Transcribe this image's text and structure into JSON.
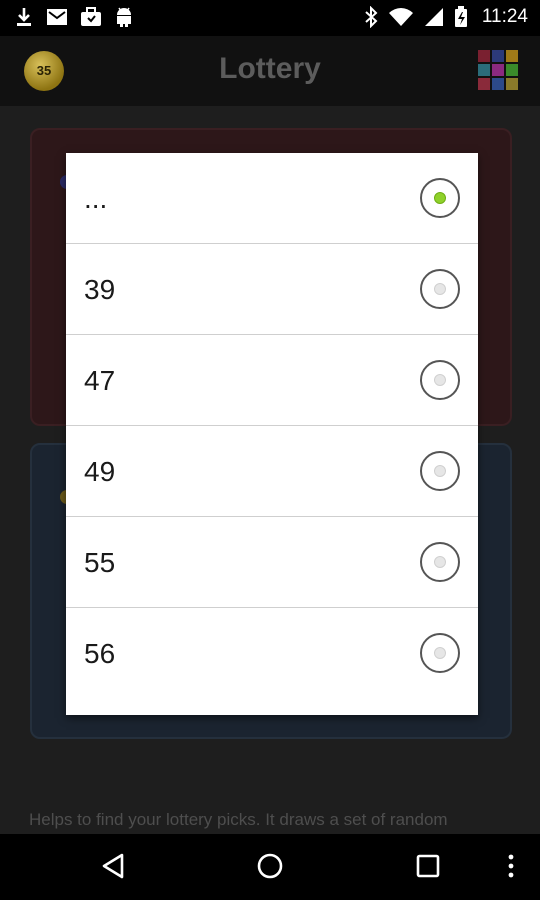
{
  "status_bar": {
    "time": "11:24",
    "left_icons": [
      "download-icon",
      "gmail-icon",
      "briefcase-icon",
      "android-icon"
    ],
    "right_icons": [
      "bluetooth-icon",
      "wifi-icon",
      "cell-signal-icon",
      "battery-icon"
    ]
  },
  "app_bar": {
    "badge_number": "35",
    "title": "Lottery",
    "menu_icon": "color-grid-icon",
    "grid_colors": [
      "#7a2030",
      "#2c3a7a",
      "#a07a18",
      "#2b6c7a",
      "#8a2a80",
      "#3a8a2a",
      "#8a2a3a",
      "#2c4a8a",
      "#8a7a2a"
    ]
  },
  "background": {
    "help_text": "Helps to find your lottery picks. It draws a set of random"
  },
  "dialog": {
    "options": [
      {
        "label": "...",
        "selected": true
      },
      {
        "label": "39",
        "selected": false
      },
      {
        "label": "47",
        "selected": false
      },
      {
        "label": "49",
        "selected": false
      },
      {
        "label": "55",
        "selected": false
      },
      {
        "label": "56",
        "selected": false
      }
    ]
  },
  "nav_bar": {
    "buttons": [
      "back-icon",
      "home-icon",
      "recents-icon",
      "overflow-menu-icon"
    ]
  }
}
